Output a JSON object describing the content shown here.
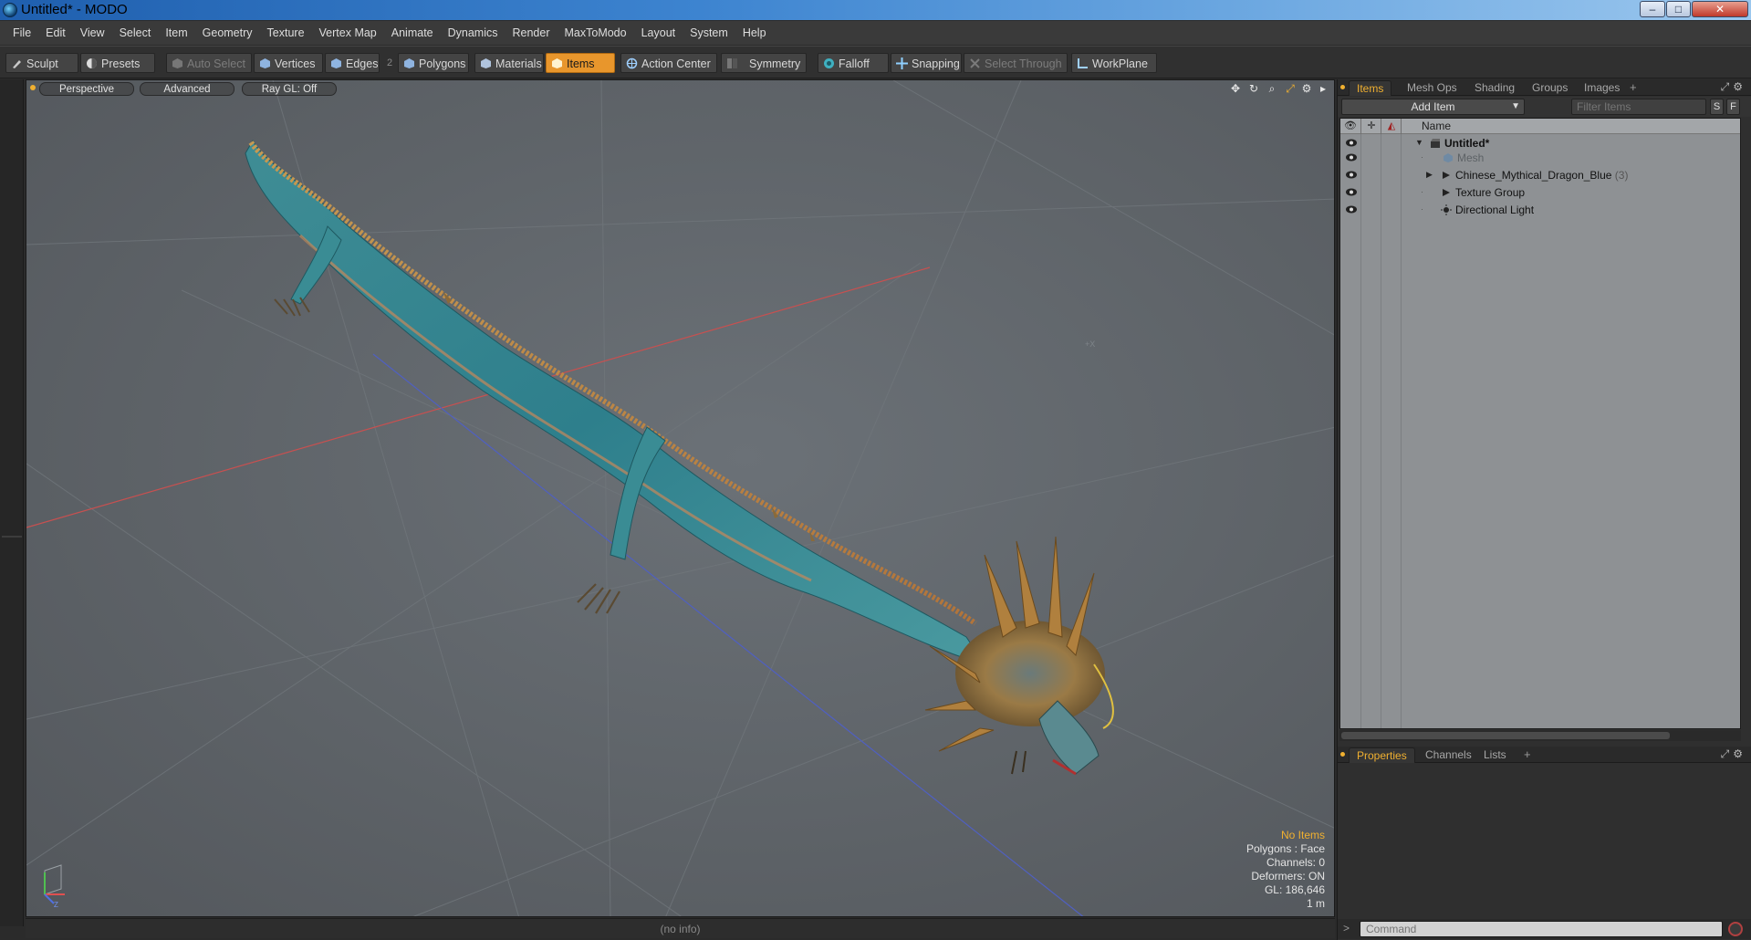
{
  "window": {
    "title": "Untitled* - MODO",
    "min": "–",
    "max": "□",
    "close": "✕"
  },
  "menu": [
    "File",
    "Edit",
    "View",
    "Select",
    "Item",
    "Geometry",
    "Texture",
    "Vertex Map",
    "Animate",
    "Dynamics",
    "Render",
    "MaxToModo",
    "Layout",
    "System",
    "Help"
  ],
  "toolbar": {
    "sculpt": "Sculpt",
    "presets": "Presets",
    "auto_select": "Auto Select",
    "vertices": "Vertices",
    "edges": "Edges",
    "edges_count": "2",
    "polygons": "Polygons",
    "materials": "Materials",
    "items": "Items",
    "action_center": "Action Center",
    "symmetry": "Symmetry",
    "falloff": "Falloff",
    "snapping": "Snapping",
    "select_through": "Select Through",
    "workplane": "WorkPlane"
  },
  "viewport": {
    "tabs": [
      "Perspective",
      "Advanced",
      "Ray GL: Off"
    ],
    "hud": {
      "selection": "No Items",
      "polygons": "Polygons : Face",
      "channels": "Channels: 0",
      "deformers": "Deformers: ON",
      "gl": "GL: 186,646",
      "scale": "1 m"
    }
  },
  "status": {
    "info": "(no info)"
  },
  "panel_top": {
    "tabs": [
      "Items",
      "Mesh Ops",
      "Shading",
      "Groups",
      "Images"
    ],
    "add_tab": "+",
    "add_item": "Add Item",
    "filter_placeholder": "Filter Items",
    "btn_s": "S",
    "btn_f": "F",
    "column_name": "Name",
    "tree": [
      {
        "label": "Untitled*",
        "count": ""
      },
      {
        "label": "Mesh",
        "count": ""
      },
      {
        "label": "Chinese_Mythical_Dragon_Blue",
        "count": "(3)"
      },
      {
        "label": "Texture Group",
        "count": ""
      },
      {
        "label": "Directional Light",
        "count": ""
      }
    ]
  },
  "panel_bottom": {
    "tabs": [
      "Properties",
      "Channels",
      "Lists"
    ],
    "add_tab": "+",
    "command_prompt": ">",
    "command_placeholder": "Command"
  },
  "colors": {
    "accent": "#f0b030",
    "active_tool": "#e8962c",
    "viewport_bg": "#5e6368"
  }
}
